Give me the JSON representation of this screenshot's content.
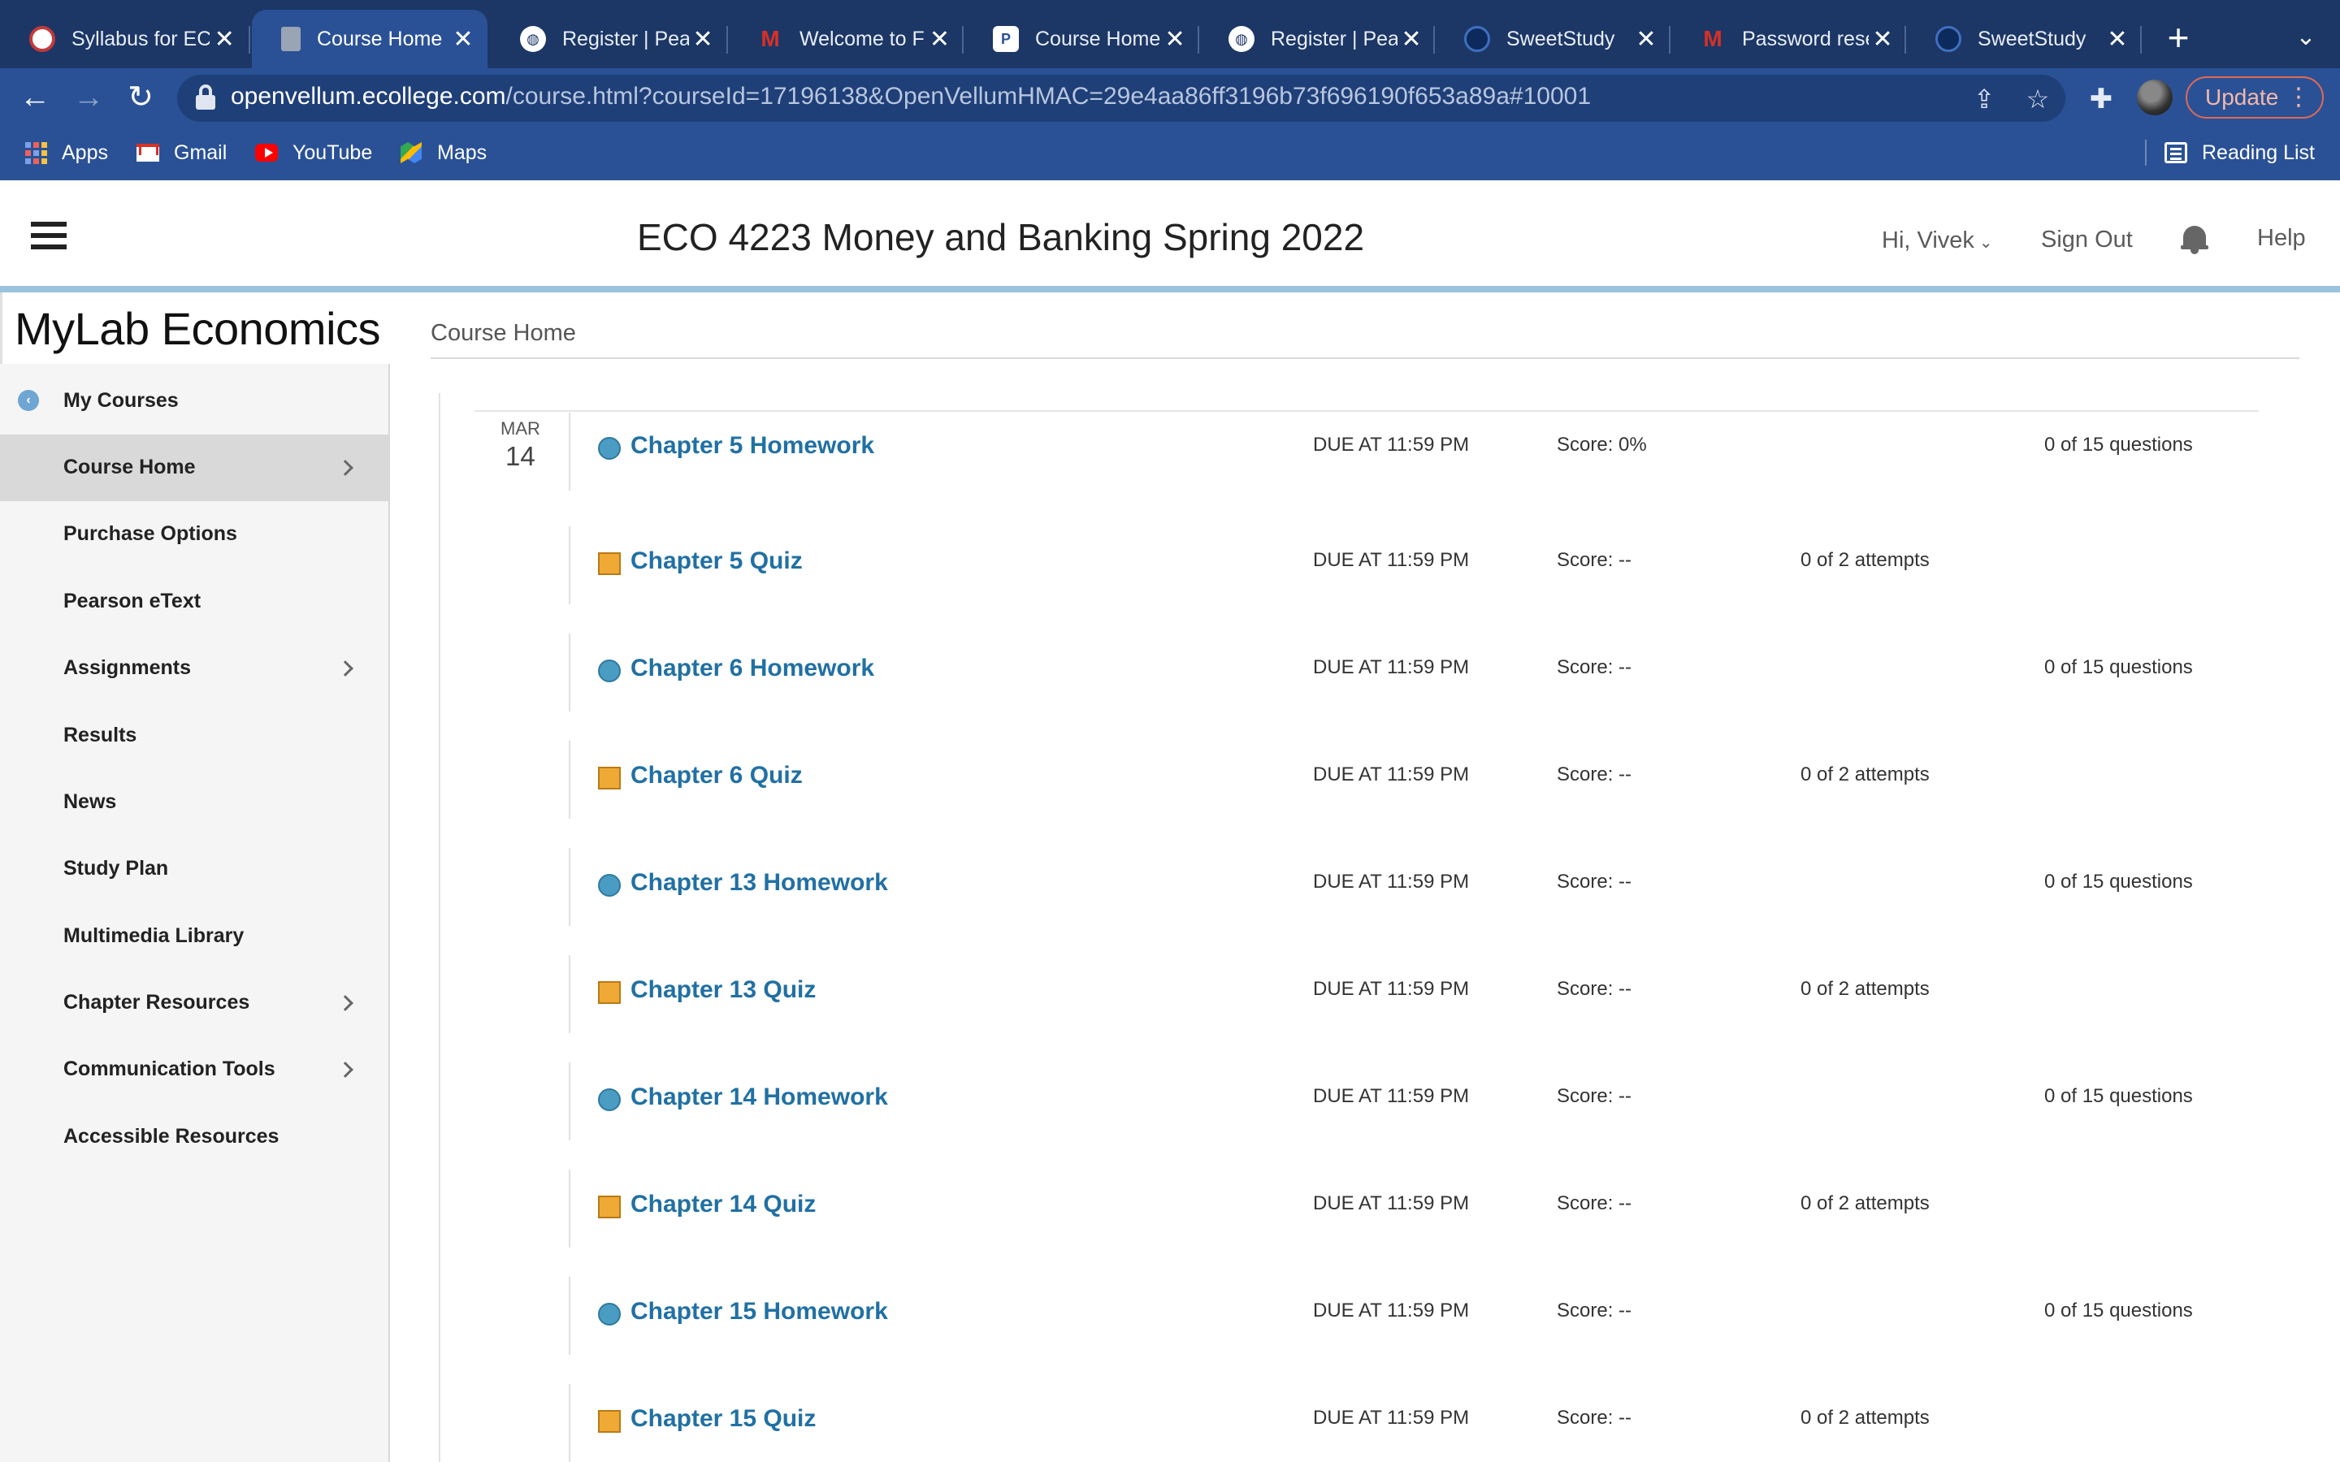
{
  "browser": {
    "tabs": [
      {
        "title": "Syllabus for EC",
        "icon": "university-seal-icon",
        "color": "#c23a3a"
      },
      {
        "title": "Course Home",
        "icon": "document-icon",
        "color": "#9aa4b4",
        "active": true
      },
      {
        "title": "Register | Pear",
        "icon": "globe-icon",
        "color": "#ffffff"
      },
      {
        "title": "Welcome to Fl",
        "icon": "gmail-icon",
        "color": "#d93025"
      },
      {
        "title": "Course Home",
        "icon": "pearson-icon",
        "color": "#3b8fc8"
      },
      {
        "title": "Register | Pear",
        "icon": "globe-icon",
        "color": "#ffffff"
      },
      {
        "title": "SweetStudy",
        "icon": "sweetstudy-icon",
        "color": "#1d4f9a"
      },
      {
        "title": "Password rese",
        "icon": "gmail-icon",
        "color": "#d93025"
      },
      {
        "title": "SweetStudy",
        "icon": "sweetstudy-icon",
        "color": "#1d4f9a"
      }
    ],
    "url_host": "openvellum.ecollege.com",
    "url_path": "/course.html?courseId=17196138&OpenVellumHMAC=29e4aa86ff3196b73f696190f653a89a#10001",
    "update_label": "Update",
    "bookmarks": [
      {
        "label": "Apps",
        "icon": "apps-grid-icon"
      },
      {
        "label": "Gmail",
        "icon": "gmail-icon"
      },
      {
        "label": "YouTube",
        "icon": "youtube-icon"
      },
      {
        "label": "Maps",
        "icon": "maps-icon"
      }
    ],
    "reading_list": "Reading List"
  },
  "header": {
    "course_title": "ECO 4223 Money and Banking Spring 2022",
    "greeting": "Hi, Vivek",
    "sign_out": "Sign Out",
    "help": "Help"
  },
  "sidebar": {
    "brand": "MyLab Economics",
    "my_courses": "My Courses",
    "items": [
      {
        "label": "Course Home",
        "active": true,
        "has_chevron": true
      },
      {
        "label": "Purchase Options",
        "has_chevron": false
      },
      {
        "label": "Pearson eText",
        "has_chevron": false
      },
      {
        "label": "Assignments",
        "has_chevron": true
      },
      {
        "label": "Results",
        "has_chevron": false
      },
      {
        "label": "News",
        "has_chevron": false
      },
      {
        "label": "Study Plan",
        "has_chevron": false
      },
      {
        "label": "Multimedia Library",
        "has_chevron": false
      },
      {
        "label": "Chapter Resources",
        "has_chevron": true
      },
      {
        "label": "Communication Tools",
        "has_chevron": true
      },
      {
        "label": "Accessible Resources",
        "has_chevron": false
      }
    ]
  },
  "main": {
    "breadcrumb": "Course Home",
    "date_month": "MAR",
    "date_day": "14",
    "assignments": [
      {
        "type": "homework",
        "title": "Chapter 5 Homework",
        "due": "DUE AT 11:59 PM",
        "score": "Score: 0%",
        "attempts": "",
        "questions": "0 of 15 questions"
      },
      {
        "type": "quiz",
        "title": "Chapter 5 Quiz",
        "due": "DUE AT 11:59 PM",
        "score": "Score: --",
        "attempts": "0 of 2 attempts",
        "questions": ""
      },
      {
        "type": "homework",
        "title": "Chapter 6 Homework",
        "due": "DUE AT 11:59 PM",
        "score": "Score: --",
        "attempts": "",
        "questions": "0 of 15 questions"
      },
      {
        "type": "quiz",
        "title": "Chapter 6 Quiz",
        "due": "DUE AT 11:59 PM",
        "score": "Score: --",
        "attempts": "0 of 2 attempts",
        "questions": ""
      },
      {
        "type": "homework",
        "title": "Chapter 13 Homework",
        "due": "DUE AT 11:59 PM",
        "score": "Score: --",
        "attempts": "",
        "questions": "0 of 15 questions"
      },
      {
        "type": "quiz",
        "title": "Chapter 13 Quiz",
        "due": "DUE AT 11:59 PM",
        "score": "Score: --",
        "attempts": "0 of 2 attempts",
        "questions": ""
      },
      {
        "type": "homework",
        "title": "Chapter 14 Homework",
        "due": "DUE AT 11:59 PM",
        "score": "Score: --",
        "attempts": "",
        "questions": "0 of 15 questions"
      },
      {
        "type": "quiz",
        "title": "Chapter 14 Quiz",
        "due": "DUE AT 11:59 PM",
        "score": "Score: --",
        "attempts": "0 of 2 attempts",
        "questions": ""
      },
      {
        "type": "homework",
        "title": "Chapter 15 Homework",
        "due": "DUE AT 11:59 PM",
        "score": "Score: --",
        "attempts": "",
        "questions": "0 of 15 questions"
      },
      {
        "type": "quiz",
        "title": "Chapter 15 Quiz",
        "due": "DUE AT 11:59 PM",
        "score": "Score: --",
        "attempts": "0 of 2 attempts",
        "questions": ""
      }
    ]
  },
  "colors": {
    "tabbar": "#1c3766",
    "toolbar": "#2a5196",
    "link": "#2170a3",
    "homework_icon": "#4a9cc3",
    "quiz_icon": "#f0a935",
    "header_rule": "#9bc3dd"
  }
}
